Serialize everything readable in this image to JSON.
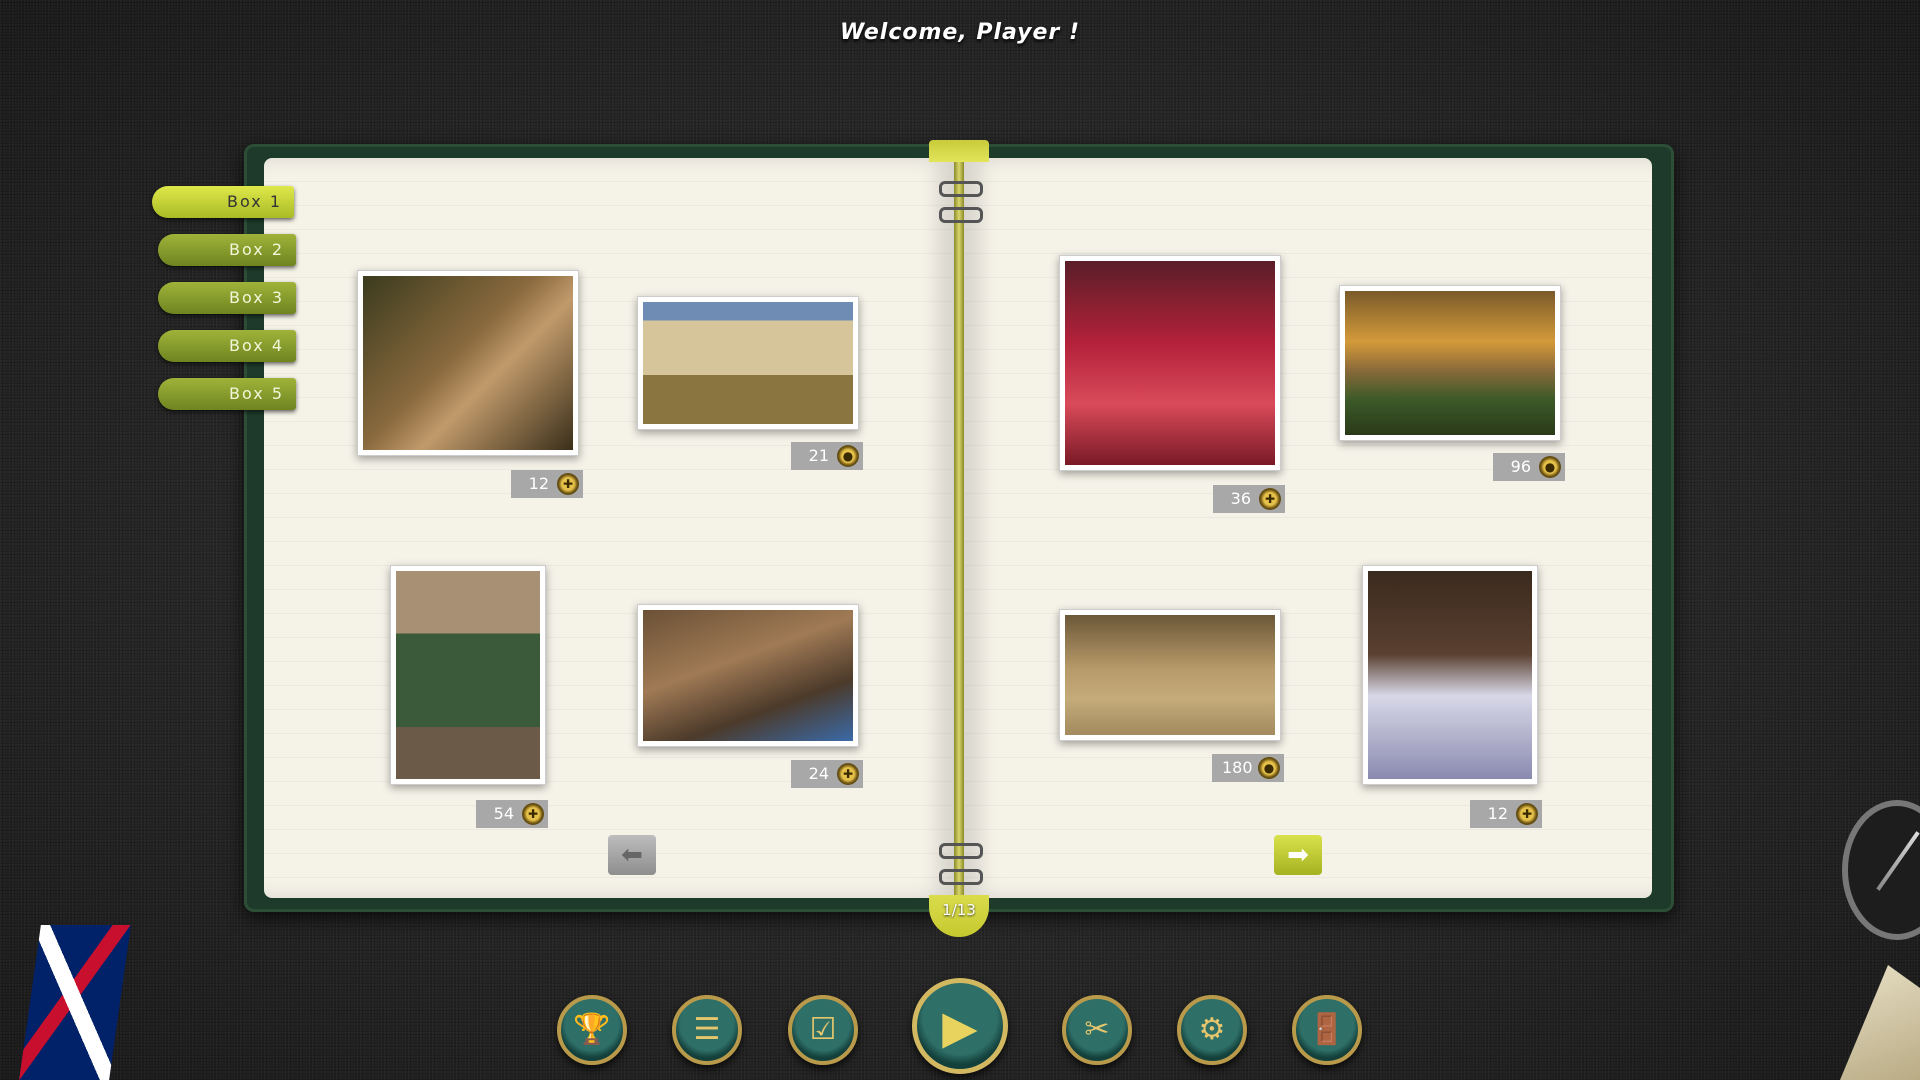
{
  "header": {
    "welcome": "Welcome, Player !"
  },
  "sidebar": {
    "tabs": [
      {
        "label": "Box 1",
        "active": true
      },
      {
        "label": "Box 2",
        "active": false
      },
      {
        "label": "Box 3",
        "active": false
      },
      {
        "label": "Box 4",
        "active": false
      },
      {
        "label": "Box 5",
        "active": false
      }
    ]
  },
  "album": {
    "page_indicator": "1/13",
    "puzzles": [
      {
        "subject": "statue",
        "pieces": "12",
        "badge_icon": "piece-icon"
      },
      {
        "subject": "clock-tower",
        "pieces": "21",
        "badge_icon": "coin-icon"
      },
      {
        "subject": "bagpiper",
        "pieces": "54",
        "badge_icon": "piece-icon"
      },
      {
        "subject": "armor-gloves",
        "pieces": "24",
        "badge_icon": "piece-icon"
      },
      {
        "subject": "veiled-woman",
        "pieces": "36",
        "badge_icon": "piece-icon"
      },
      {
        "subject": "castle",
        "pieces": "96",
        "badge_icon": "coin-icon"
      },
      {
        "subject": "amphorae",
        "pieces": "180",
        "badge_icon": "coin-icon"
      },
      {
        "subject": "woman-white-dress",
        "pieces": "12",
        "badge_icon": "piece-icon"
      }
    ],
    "prev_arrow": "⬅",
    "next_arrow": "➡"
  },
  "toolbar": {
    "buttons": [
      {
        "name": "trophy-button",
        "icon": "trophy-icon",
        "glyph": "🏆"
      },
      {
        "name": "leaderboard-button",
        "icon": "list-icon",
        "glyph": "☰"
      },
      {
        "name": "checklist-button",
        "icon": "checkbox-icon",
        "glyph": "☑"
      },
      {
        "name": "play-button",
        "icon": "play-icon",
        "glyph": "▶"
      },
      {
        "name": "scissors-button",
        "icon": "scissors-icon",
        "glyph": "✂"
      },
      {
        "name": "settings-button",
        "icon": "gear-icon",
        "glyph": "⚙"
      },
      {
        "name": "exit-button",
        "icon": "door-icon",
        "glyph": "🚪"
      }
    ]
  },
  "colors": {
    "accent_green": "#c8cc3a",
    "tab_green": "#8fa12e",
    "button_teal": "#2e6f68",
    "button_gold": "#b89a4a"
  }
}
